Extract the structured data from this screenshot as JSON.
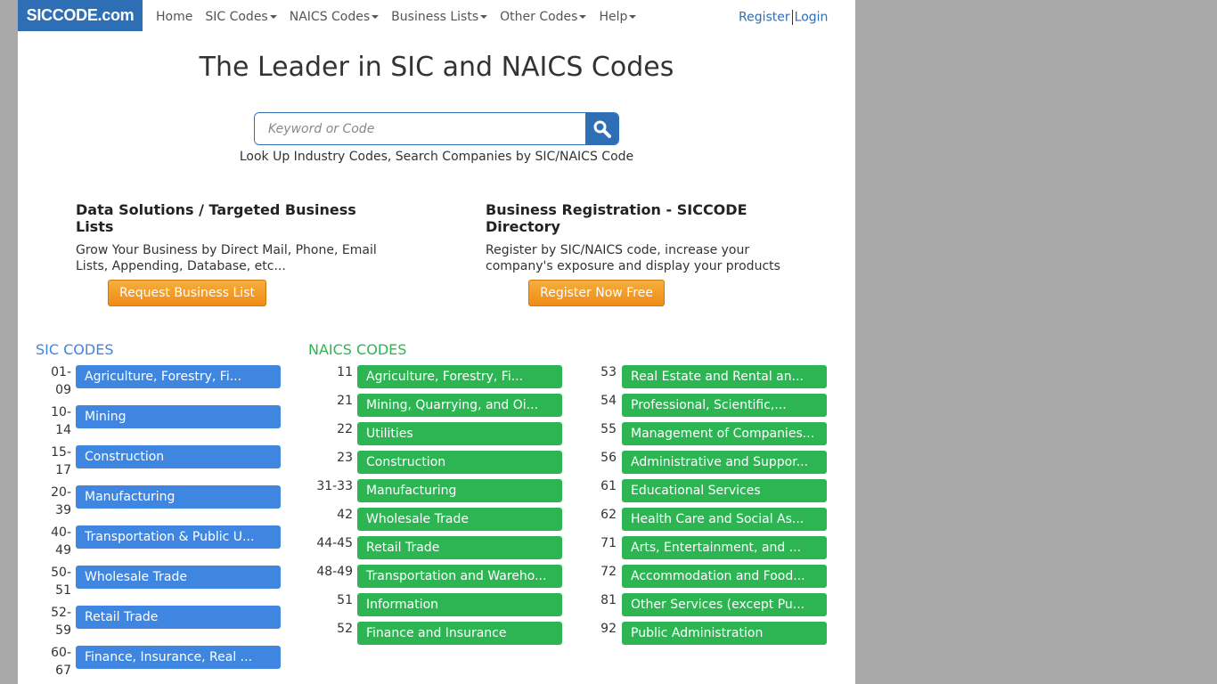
{
  "header": {
    "logo": "SICCODE.com",
    "nav": [
      {
        "label": "Home",
        "dropdown": false
      },
      {
        "label": "SIC Codes",
        "dropdown": true
      },
      {
        "label": "NAICS Codes",
        "dropdown": true
      },
      {
        "label": "Business Lists",
        "dropdown": true
      },
      {
        "label": "Other Codes",
        "dropdown": true
      },
      {
        "label": "Help",
        "dropdown": true
      }
    ],
    "register": "Register",
    "login": "Login"
  },
  "main": {
    "title": "The Leader in SIC and NAICS Codes",
    "search_placeholder": "Keyword or Code",
    "tagline": "Look Up Industry Codes, Search Companies by SIC/NAICS Code"
  },
  "promos": [
    {
      "title": "Data Solutions / Targeted Business Lists",
      "text": "Grow Your Business by Direct Mail, Phone, Email Lists, Appending, Database, etc...",
      "button": "Request Business List"
    },
    {
      "title": "Business Registration - SICCODE Directory",
      "text": "Register by SIC/NAICS code, increase your company's exposure and display your products",
      "button": "Register Now Free"
    }
  ],
  "sic": {
    "heading": "SIC CODES",
    "items": [
      {
        "code1": "01-",
        "code2": "09",
        "label": "Agriculture, Forestry, Fi..."
      },
      {
        "code1": "10-",
        "code2": "14",
        "label": "Mining"
      },
      {
        "code1": "15-",
        "code2": "17",
        "label": "Construction"
      },
      {
        "code1": "20-",
        "code2": "39",
        "label": "Manufacturing"
      },
      {
        "code1": "40-",
        "code2": "49",
        "label": "Transportation & Public U..."
      },
      {
        "code1": "50-",
        "code2": "51",
        "label": "Wholesale Trade"
      },
      {
        "code1": "52-",
        "code2": "59",
        "label": "Retail Trade"
      },
      {
        "code1": "60-",
        "code2": "67",
        "label": "Finance, Insurance, Real ..."
      }
    ]
  },
  "naics": {
    "heading": "NAICS CODES",
    "col1": [
      {
        "code": "11",
        "label": "Agriculture, Forestry, Fi..."
      },
      {
        "code": "21",
        "label": "Mining, Quarrying, and Oi..."
      },
      {
        "code": "22",
        "label": "Utilities"
      },
      {
        "code": "23",
        "label": "Construction"
      },
      {
        "code": "31-33",
        "label": "Manufacturing"
      },
      {
        "code": "42",
        "label": "Wholesale Trade"
      },
      {
        "code": "44-45",
        "label": "Retail Trade"
      },
      {
        "code": "48-49",
        "label": "Transportation and Wareho..."
      },
      {
        "code": "51",
        "label": "Information"
      },
      {
        "code": "52",
        "label": "Finance and Insurance"
      }
    ],
    "col2": [
      {
        "code": "53",
        "label": "Real Estate and Rental an..."
      },
      {
        "code": "54",
        "label": "Professional, Scientific,..."
      },
      {
        "code": "55",
        "label": "Management of Companies..."
      },
      {
        "code": "56",
        "label": "Administrative and Suppor..."
      },
      {
        "code": "61",
        "label": "Educational Services"
      },
      {
        "code": "62",
        "label": "Health Care and Social As..."
      },
      {
        "code": "71",
        "label": "Arts, Entertainment, and ..."
      },
      {
        "code": "72",
        "label": "Accommodation and Food..."
      },
      {
        "code": "81",
        "label": "Other Services (except Pu..."
      },
      {
        "code": "92",
        "label": "Public Administration"
      }
    ]
  },
  "colors": {
    "sic": "#3f86e0",
    "naics": "#2db553",
    "brand": "#2e6eb5",
    "cta": "#f0931b"
  }
}
